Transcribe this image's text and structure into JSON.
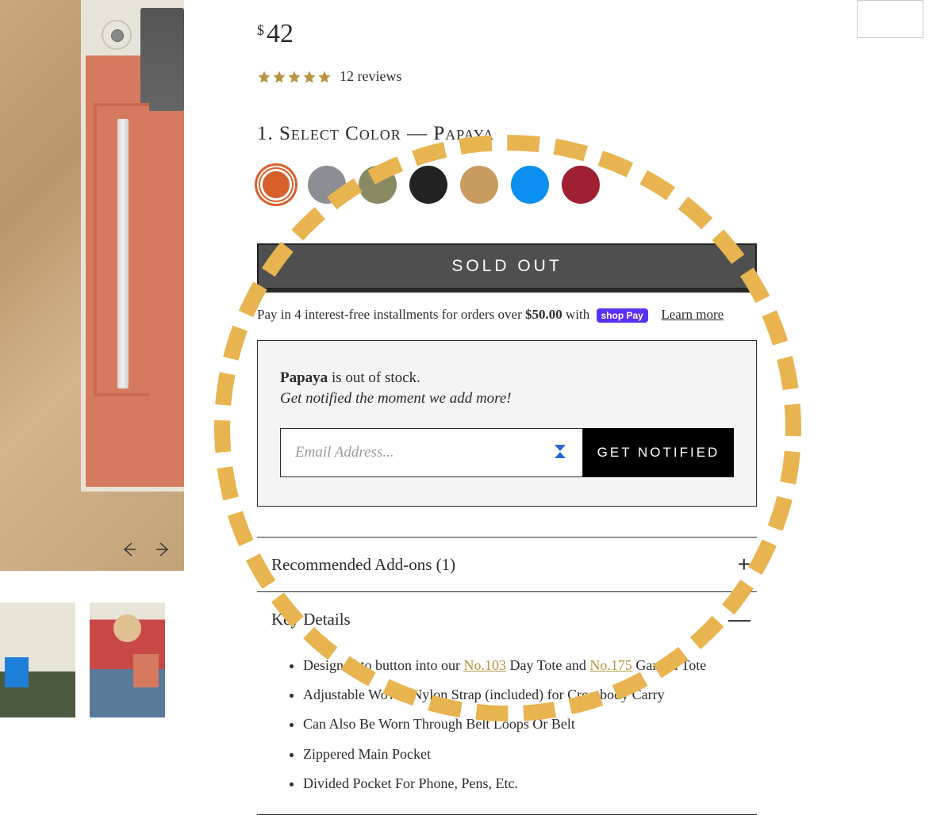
{
  "price": {
    "currency": "$",
    "amount": "42"
  },
  "rating": {
    "stars": 5,
    "count_label": "12 reviews"
  },
  "color_select": {
    "prefix": "1. Select Color — ",
    "selected": "Papaya"
  },
  "swatches": [
    {
      "name": "Papaya",
      "hex": "#d8602a",
      "selected": true
    },
    {
      "name": "Grey",
      "hex": "#8b8e93",
      "selected": false
    },
    {
      "name": "Olive",
      "hex": "#898a63",
      "selected": false
    },
    {
      "name": "Black",
      "hex": "#222222",
      "selected": false
    },
    {
      "name": "Tan",
      "hex": "#c89b5f",
      "selected": false
    },
    {
      "name": "Blue",
      "hex": "#0b8ff0",
      "selected": false
    },
    {
      "name": "Burgundy",
      "hex": "#9f1f33",
      "selected": false
    }
  ],
  "sold_out_label": "SOLD OUT",
  "installments": {
    "text_before": "Pay in 4 interest-free installments for orders over ",
    "threshold": "$50.00",
    "text_after": " with ",
    "brand": "shop Pay",
    "learn": "Learn more"
  },
  "notify": {
    "variant": "Papaya",
    "oos_suffix": " is out of stock.",
    "sub": "Get notified the moment we add more!",
    "placeholder": "Email Address...",
    "button": "GET NOTIFIED"
  },
  "accordions": {
    "addons": {
      "title": "Recommended Add-ons (1)",
      "icon": "+"
    },
    "key_details": {
      "title": "Key Details",
      "icon": "—",
      "items": [
        {
          "pre": "Designed to button into our ",
          "link1": "No.103",
          "mid": " Day Tote and ",
          "link2": "No.175",
          "post": " Garden Tote"
        },
        {
          "text": "Adjustable Woven Nylon Strap (included) for Crossbody Carry"
        },
        {
          "text": "Can Also Be Worn Through Belt Loops Or Belt"
        },
        {
          "text": "Zippered Main Pocket"
        },
        {
          "text": "Divided Pocket For Phone, Pens, Etc."
        }
      ]
    }
  }
}
